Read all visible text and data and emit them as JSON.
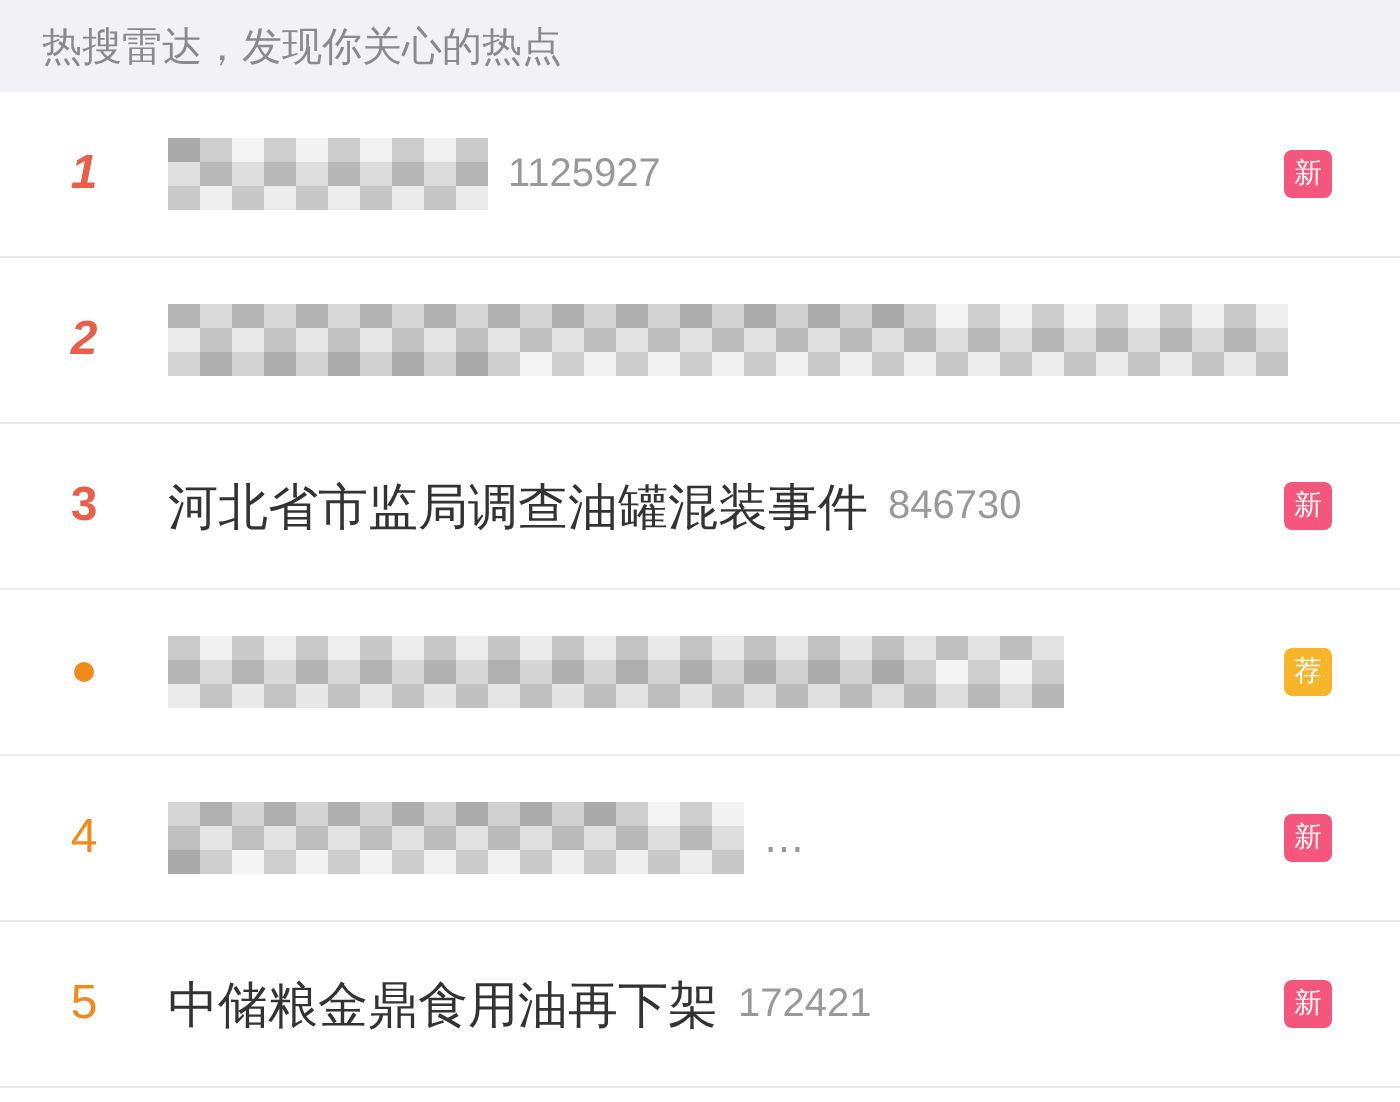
{
  "header": {
    "text": "热搜雷达，发现你关心的热点"
  },
  "rows": [
    {
      "rank": {
        "kind": "number",
        "text": "1",
        "color": "#e8604c"
      },
      "kind": "pixelated",
      "count": "1125927",
      "badge": {
        "text": "新",
        "color": "#f4577b"
      }
    },
    {
      "rank": {
        "kind": "number",
        "text": "2",
        "color": "#e8604c"
      },
      "kind": "pixelated"
    },
    {
      "rank": {
        "kind": "number",
        "text": "3",
        "color": "#e8604c"
      },
      "kind": "text",
      "title": "河北省市监局调查油罐混装事件",
      "count": "846730",
      "badge": {
        "text": "新",
        "color": "#f4577b"
      }
    },
    {
      "rank": {
        "kind": "dot",
        "color": "#f08a1c"
      },
      "kind": "pixelated",
      "badge": {
        "text": "荐",
        "color": "#f7b52c"
      }
    },
    {
      "rank": {
        "kind": "number",
        "text": "4",
        "color": "#f08a1c"
      },
      "kind": "pixelated",
      "title": "…",
      "badge": {
        "text": "新",
        "color": "#f4577b"
      }
    },
    {
      "rank": {
        "kind": "number",
        "text": "5",
        "color": "#f08a1c"
      },
      "kind": "text",
      "title": "中储粮金鼎食用油再下架",
      "count": "172421",
      "badge": {
        "text": "新",
        "color": "#f4577b"
      }
    }
  ]
}
